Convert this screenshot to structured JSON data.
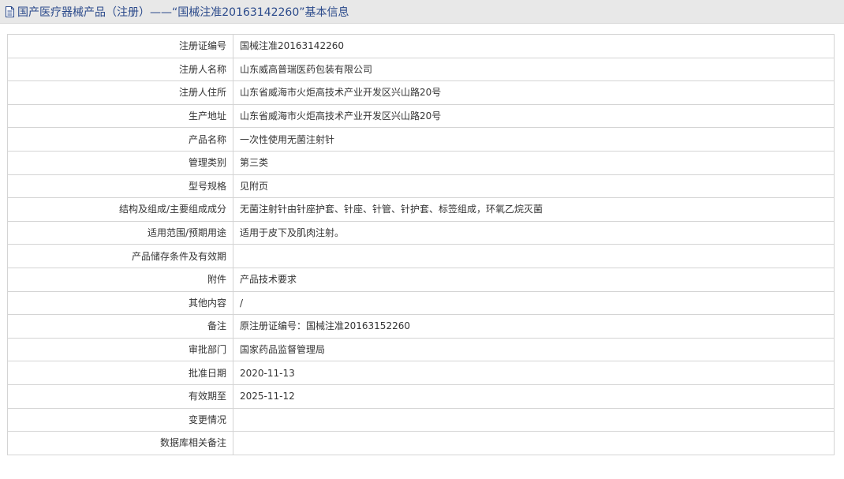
{
  "header": {
    "title": "国产医疗器械产品（注册）——“国械注准20163142260”基本信息",
    "icon": "document-icon",
    "title_color": "#2b4a8b"
  },
  "rows": [
    {
      "label": "注册证编号",
      "value": "国械注准20163142260"
    },
    {
      "label": "注册人名称",
      "value": "山东威高普瑞医药包装有限公司"
    },
    {
      "label": "注册人住所",
      "value": "山东省威海市火炬高技术产业开发区兴山路20号"
    },
    {
      "label": "生产地址",
      "value": "山东省威海市火炬高技术产业开发区兴山路20号"
    },
    {
      "label": "产品名称",
      "value": "一次性使用无菌注射针"
    },
    {
      "label": "管理类别",
      "value": "第三类"
    },
    {
      "label": "型号规格",
      "value": "见附页"
    },
    {
      "label": "结构及组成/主要组成成分",
      "value": "无菌注射针由针座护套、针座、针管、针护套、标签组成，环氧乙烷灭菌"
    },
    {
      "label": "适用范围/预期用途",
      "value": "适用于皮下及肌肉注射。"
    },
    {
      "label": "产品储存条件及有效期",
      "value": ""
    },
    {
      "label": "附件",
      "value": "产品技术要求"
    },
    {
      "label": "其他内容",
      "value": "/"
    },
    {
      "label": "备注",
      "value": "原注册证编号：国械注准20163152260"
    },
    {
      "label": "审批部门",
      "value": "国家药品监督管理局"
    },
    {
      "label": "批准日期",
      "value": "2020-11-13"
    },
    {
      "label": "有效期至",
      "value": "2025-11-12"
    },
    {
      "label": "变更情况",
      "value": ""
    },
    {
      "label": "数据库相关备注",
      "value": ""
    }
  ]
}
